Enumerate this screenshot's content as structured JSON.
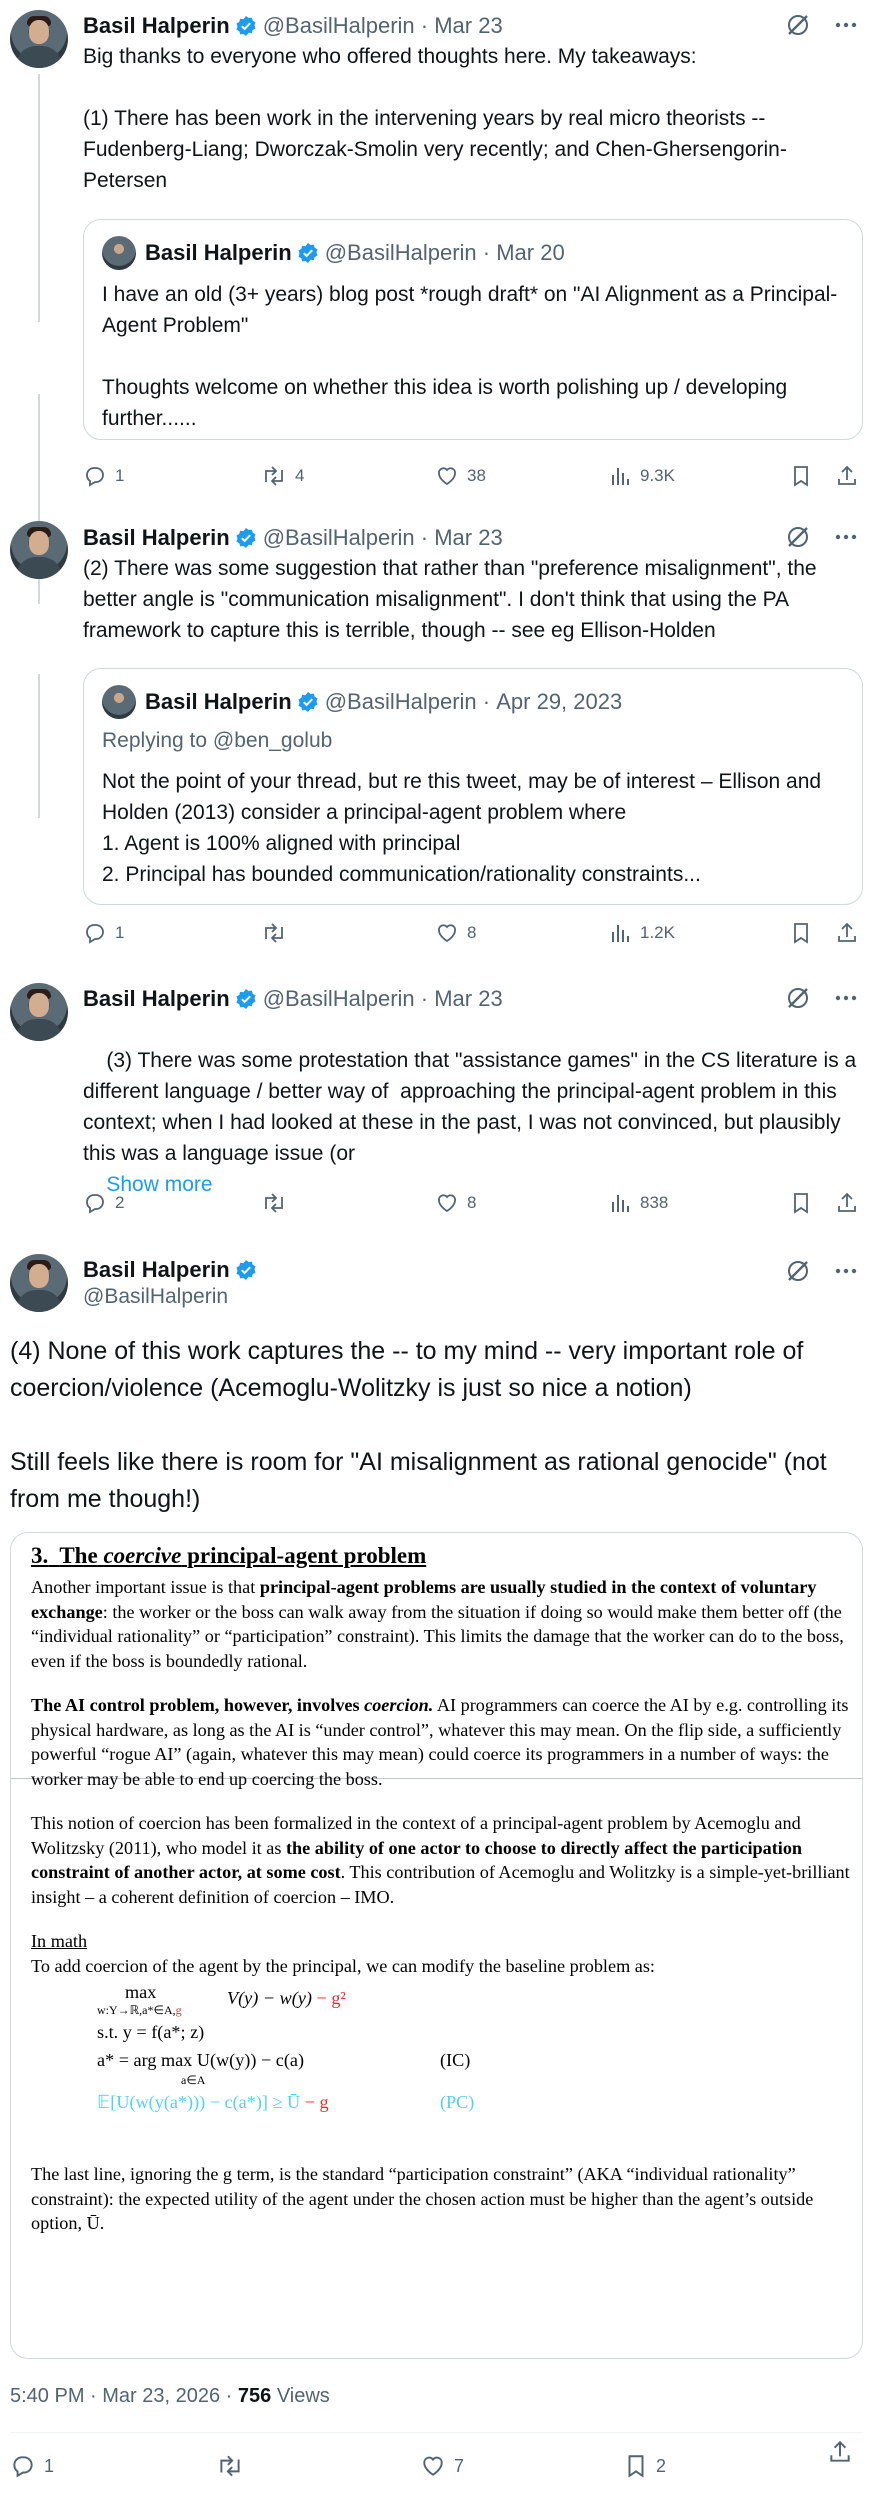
{
  "tweets": [
    {
      "name": "Basil Halperin",
      "handle": "@BasilHalperin",
      "date": "Mar 23",
      "text": "Big thanks to everyone who offered thoughts here. My takeaways:\n\n(1) There has been work in the intervening years by real micro theorists -- Fudenberg-Liang; Dworczak-Smolin very recently; and Chen-Ghersengorin-Petersen",
      "quote": {
        "name": "Basil Halperin",
        "handle": "@BasilHalperin",
        "date": "Mar 20",
        "text": "I have an old (3+ years) blog post *rough draft* on \"AI Alignment as a Principal-Agent Problem\"\n\nThoughts welcome on whether this idea is worth polishing up / developing further......"
      },
      "stats": {
        "replies": "1",
        "reposts": "4",
        "likes": "38",
        "views": "9.3K"
      }
    },
    {
      "name": "Basil Halperin",
      "handle": "@BasilHalperin",
      "date": "Mar 23",
      "text": "(2) There was some suggestion that rather than \"preference misalignment\", the better angle is \"communication misalignment\". I don't think that using the PA framework to capture this is terrible, though -- see eg Ellison-Holden",
      "quote": {
        "name": "Basil Halperin",
        "handle": "@BasilHalperin",
        "date": "Apr 29, 2023",
        "replying_to": "Replying to @ben_golub",
        "text": "Not the point of your thread, but re this tweet, may be of interest – Ellison and Holden (2013) consider a principal-agent problem where\n1. Agent is 100% aligned with principal\n2. Principal has bounded communication/rationality constraints..."
      },
      "stats": {
        "replies": "1",
        "reposts": "",
        "likes": "8",
        "views": "1.2K"
      }
    },
    {
      "name": "Basil Halperin",
      "handle": "@BasilHalperin",
      "date": "Mar 23",
      "text": "(3) There was some protestation that \"assistance games\" in the CS literature is a different language / better way of  approaching the principal-agent problem in this context; when I had looked at these in the past, I was not convinced, but plausibly this was a language issue (or",
      "show_more": "Show more",
      "stats": {
        "replies": "2",
        "reposts": "",
        "likes": "8",
        "views": "838"
      }
    }
  ],
  "main_tweet": {
    "name": "Basil Halperin",
    "handle": "@BasilHalperin",
    "text": "(4) None of this work captures the -- to my mind -- very important role of coercion/violence (Acemoglu-Wolitzky is just so nice a notion)\n\nStill feels like there is room for \"AI misalignment as rational genocide\" (not from me though!)",
    "image": {
      "heading_num": "3.",
      "heading_pre": "The",
      "heading_em": "coercive",
      "heading_post": "principal-agent problem",
      "p1_a": "Another important issue is that ",
      "p1_b": "principal-agent problems are usually studied in the context of voluntary exchange",
      "p1_c": ": the worker or the boss can walk away from the situation if doing so would make them better off (the “individual rationality” or “participation” constraint). This limits the damage that the worker can do to the boss, even if the boss is boundedly rational.",
      "p2_a": "The AI control problem, however, involves ",
      "p2_b": "coercion.",
      "p2_c": " AI programmers can coerce the AI by e.g. controlling its physical hardware, as long as the AI is “under control”, whatever this may mean. On the flip side, a sufficiently powerful “rogue AI” (again, whatever this may mean) could coerce its programmers in a number of ways: the worker may be able to end up coercing the boss.",
      "p3_a": "This notion of coercion has been formalized in the context of a principal-agent problem by Acemoglu and Wolitzsky (2011), who model it as ",
      "p3_b": "the ability of one actor to choose to directly affect the participation constraint of another actor, at some cost",
      "p3_c": ". This contribution of Acemoglu and Wolitzky is a simple-yet-brilliant insight – a coherent definition of coercion – IMO.",
      "in_math": "In math",
      "in_math_intro": "To add coercion of the agent by the principal, we can modify the baseline problem as:",
      "eq_max": "max",
      "eq_max_sub_a": "w:Y→ℝ,a*∈A,",
      "eq_max_sub_b": "g",
      "eq_obj_a": "V(y) − w(y) ",
      "eq_obj_b": "− g²",
      "eq_st": "s.t. y = f(a*; z)",
      "eq_ic_a": "a* = arg max U(w(y)) − c(a)",
      "eq_ic_sub": "a∈A",
      "eq_ic_label": "(IC)",
      "eq_pc_a": "𝔼[U(w(y(a*))) − c(a*)] ≥ Ū ",
      "eq_pc_b": "− g",
      "eq_pc_label": "(PC)",
      "p4": "The last line, ignoring the g term, is the standard “participation constraint” (AKA “individual rationality” constraint): the expected utility of the agent under the chosen action must be higher than the agent’s outside option, Ū."
    },
    "timestamp": "5:40 PM · Mar 23, 2026 · ",
    "views_count": "756",
    "views_label": " Views",
    "stats": {
      "replies": "1",
      "reposts": "",
      "likes": "7",
      "bookmarks": "2"
    }
  }
}
